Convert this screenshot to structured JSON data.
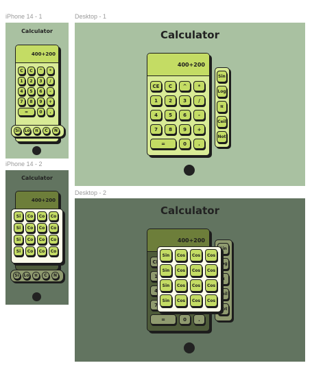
{
  "frames": {
    "iphone1": "iPhone 14 - 1",
    "iphone2": "iPhone 14 - 2",
    "desktop1": "Desktop - 1",
    "desktop2": "Desktop - 2"
  },
  "app_title": "Calculator",
  "display_value": "400+200",
  "keypad_desktop": [
    "CE",
    "C",
    "^",
    "*",
    "1",
    "2",
    "3",
    "/",
    "4",
    "5",
    "6",
    "-",
    "7",
    "8",
    "9",
    "+",
    "=",
    "0",
    "."
  ],
  "keypad_mobile": [
    "C",
    "C",
    "^",
    "*",
    "1",
    "2",
    "3",
    "/",
    "4",
    "5",
    "6",
    "-",
    "7",
    "8",
    "9",
    "+",
    "=",
    "0",
    "."
  ],
  "side_panel_desktop": [
    "Sin",
    "Log",
    "π",
    "Ceil",
    "Not"
  ],
  "side_panel_mobile": [
    "Si",
    "Lo",
    "π",
    "C",
    "N"
  ],
  "popup_desktop": [
    "Sin",
    "Cos",
    "Cos",
    "Cos",
    "Sin",
    "Cos",
    "Cos",
    "Cos",
    "Sin",
    "Cos",
    "Cos",
    "Cos",
    "Sin",
    "Cos",
    "Cos",
    "Cos"
  ],
  "popup_mobile": [
    "Si",
    "Co",
    "Co",
    "Co",
    "Si",
    "Co",
    "Co",
    "Co",
    "Si",
    "Co",
    "Co",
    "Co",
    "Si",
    "Co",
    "Co",
    "Co"
  ],
  "colors": {
    "frame_light": "#a9c1a1",
    "frame_dark": "#627460",
    "accent_green": "#c4dc64",
    "button_green": "#d9eb96",
    "screen_dark": "#6d7e3a",
    "button_dim": "#8f9a6f",
    "outline": "#1d1d1d"
  }
}
